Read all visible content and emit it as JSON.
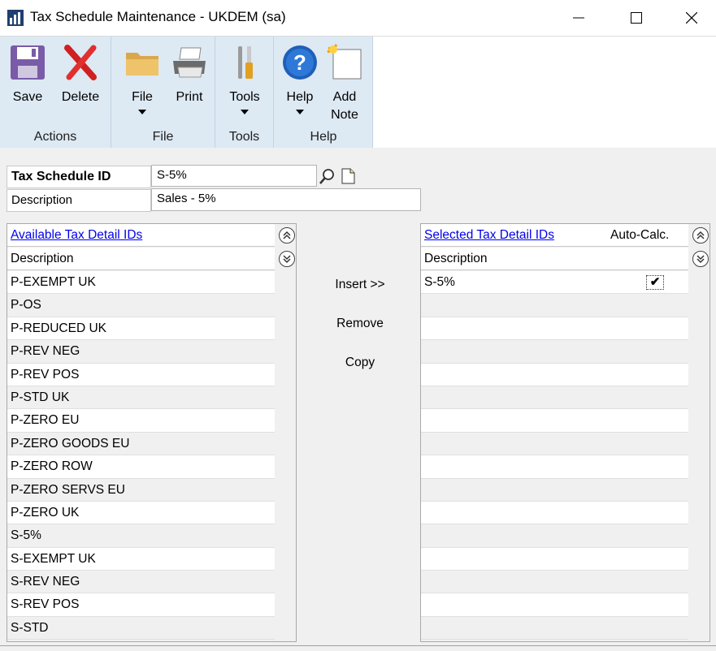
{
  "window": {
    "title": "Tax Schedule Maintenance  -  UKDEM (sa)",
    "minimize_glyph": "—",
    "maximize_glyph": "☐",
    "close_glyph": "✕"
  },
  "ribbon": {
    "groups": [
      {
        "label": "Actions",
        "buttons": [
          {
            "label": "Save",
            "icon": "save-icon"
          },
          {
            "label": "Delete",
            "icon": "delete-icon"
          }
        ]
      },
      {
        "label": "File",
        "buttons": [
          {
            "label": "File",
            "icon": "folder-icon"
          },
          {
            "label": "Print",
            "icon": "printer-icon"
          }
        ]
      },
      {
        "label": "Tools",
        "buttons": [
          {
            "label": "Tools",
            "icon": "tools-icon"
          }
        ]
      },
      {
        "label": "Help",
        "buttons": [
          {
            "label": "Help",
            "icon": "help-icon"
          },
          {
            "label": "Add\nNote",
            "icon": "note-icon"
          }
        ]
      }
    ]
  },
  "form": {
    "tax_schedule_id_label": "Tax Schedule ID",
    "tax_schedule_id_value": "S-5%",
    "description_label": "Description",
    "description_value": "Sales - 5%"
  },
  "available": {
    "header": "Available Tax Detail IDs",
    "column": "Description",
    "rows": [
      "P-EXEMPT UK",
      "P-OS",
      "P-REDUCED UK",
      "P-REV NEG",
      "P-REV POS",
      "P-STD UK",
      "P-ZERO EU",
      "P-ZERO GOODS EU",
      "P-ZERO ROW",
      "P-ZERO SERVS EU",
      "P-ZERO UK",
      "S-5%",
      "S-EXEMPT UK",
      "S-REV NEG",
      "S-REV POS",
      "S-STD"
    ]
  },
  "actions": {
    "insert": "Insert >>",
    "remove": "Remove",
    "copy": "Copy"
  },
  "selected": {
    "header": "Selected Tax Detail IDs",
    "auto_calc_label": "Auto-Calc.",
    "column": "Description",
    "rows": [
      "S-5%",
      "",
      "",
      "",
      "",
      "",
      "",
      "",
      "",
      "",
      "",
      "",
      "",
      "",
      "",
      ""
    ],
    "first_row_auto_calc": "✔"
  }
}
